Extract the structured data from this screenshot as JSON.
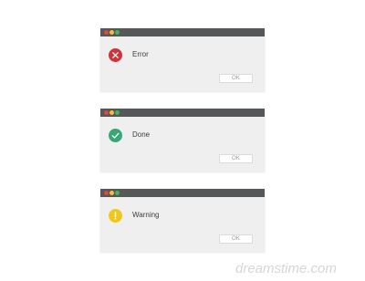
{
  "colors": {
    "titlebar": "#555759",
    "dialog_bg": "#efefef",
    "dot_red": "#e0483e",
    "dot_yellow": "#f1c232",
    "dot_green": "#3fb55f",
    "error_icon": "#d6303a",
    "done_icon": "#3aa675",
    "warning_icon": "#f2c71c"
  },
  "dialogs": [
    {
      "type": "error",
      "icon": "error-x-icon",
      "message": "Error",
      "button_label": "OK"
    },
    {
      "type": "done",
      "icon": "checkmark-icon",
      "message": "Done",
      "button_label": "OK"
    },
    {
      "type": "warning",
      "icon": "exclamation-icon",
      "message": "Warning",
      "button_label": "OK"
    }
  ],
  "watermark": "dreamstime.com"
}
